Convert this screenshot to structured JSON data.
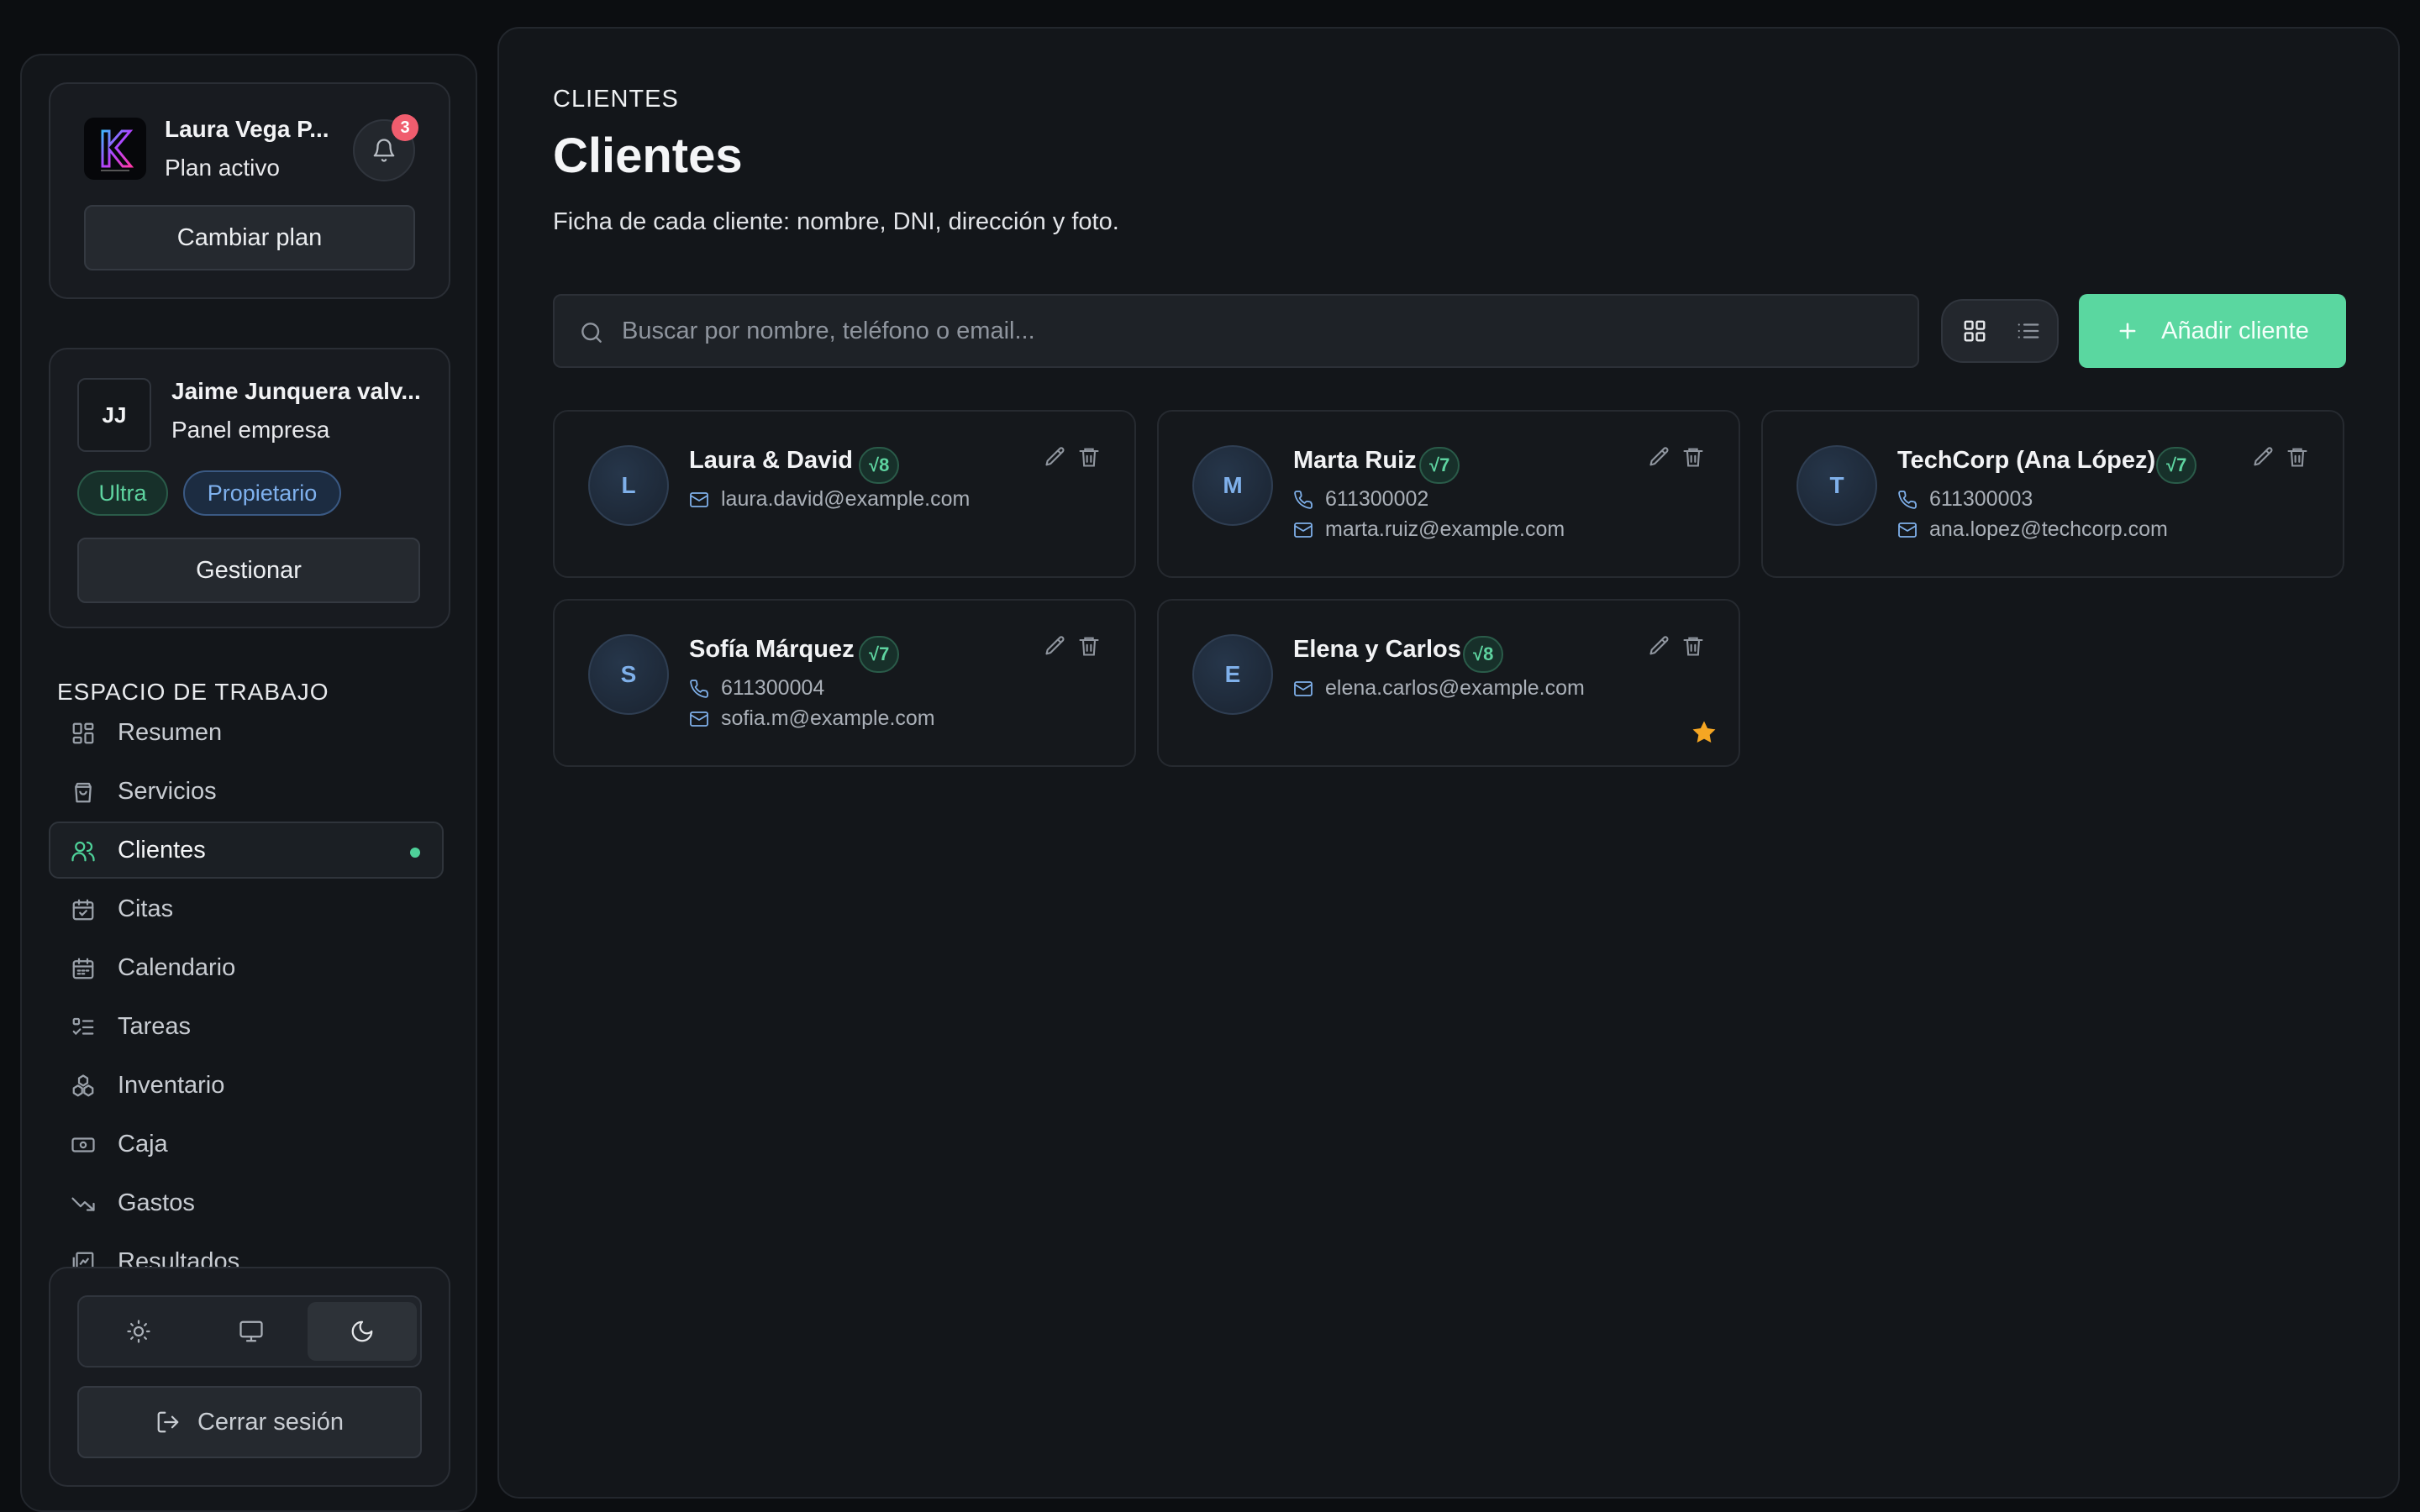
{
  "account": {
    "name": "Laura Vega P...",
    "plan_status": "Plan activo",
    "notifications_count": "3",
    "change_plan_label": "Cambiar plan"
  },
  "company": {
    "initials": "JJ",
    "name": "Jaime Junquera valv...",
    "subtitle": "Panel empresa",
    "tags": [
      "Ultra",
      "Propietario"
    ],
    "manage_label": "Gestionar"
  },
  "sidebar": {
    "section_label": "ESPACIO DE TRABAJO",
    "items": [
      {
        "label": "Resumen",
        "icon": "dashboard-icon"
      },
      {
        "label": "Servicios",
        "icon": "shopping-bag-icon"
      },
      {
        "label": "Clientes",
        "icon": "users-icon",
        "active": true
      },
      {
        "label": "Citas",
        "icon": "calendar-check-icon"
      },
      {
        "label": "Calendario",
        "icon": "calendar-icon"
      },
      {
        "label": "Tareas",
        "icon": "list-checks-icon"
      },
      {
        "label": "Inventario",
        "icon": "boxes-icon"
      },
      {
        "label": "Caja",
        "icon": "banknote-icon"
      },
      {
        "label": "Gastos",
        "icon": "trending-down-icon"
      },
      {
        "label": "Resultados",
        "icon": "chart-image-icon"
      }
    ],
    "theme_options": [
      "sun-icon",
      "monitor-icon",
      "moon-icon"
    ],
    "theme_selected": "moon-icon",
    "logout_label": "Cerrar sesión"
  },
  "main": {
    "breadcrumb": "CLIENTES",
    "title": "Clientes",
    "description": "Ficha de cada cliente: nombre, DNI, dirección y foto.",
    "search_placeholder": "Buscar por nombre, teléfono o email...",
    "view_modes": [
      "grid-icon",
      "list-icon"
    ],
    "add_label": "Añadir cliente"
  },
  "clients": [
    {
      "initial": "L",
      "name": "Laura & David",
      "badge": "√8",
      "phone": "",
      "email": "laura.david@example.com",
      "starred": false
    },
    {
      "initial": "M",
      "name": "Marta Ruiz",
      "badge": "√7",
      "phone": "611300002",
      "email": "marta.ruiz@example.com",
      "starred": false
    },
    {
      "initial": "T",
      "name": "TechCorp (Ana López)",
      "badge": "√7",
      "phone": "611300003",
      "email": "ana.lopez@techcorp.com",
      "starred": false
    },
    {
      "initial": "S",
      "name": "Sofía Márquez",
      "badge": "√7",
      "phone": "611300004",
      "email": "sofia.m@example.com",
      "starred": false
    },
    {
      "initial": "E",
      "name": "Elena y Carlos",
      "badge": "√8",
      "phone": "",
      "email": "elena.carlos@example.com",
      "starred": true
    }
  ],
  "colors": {
    "accent": "#5ad7a0",
    "badge_red": "#f05d6e",
    "star": "#f5a623",
    "link_blue": "#7fb0ea"
  }
}
